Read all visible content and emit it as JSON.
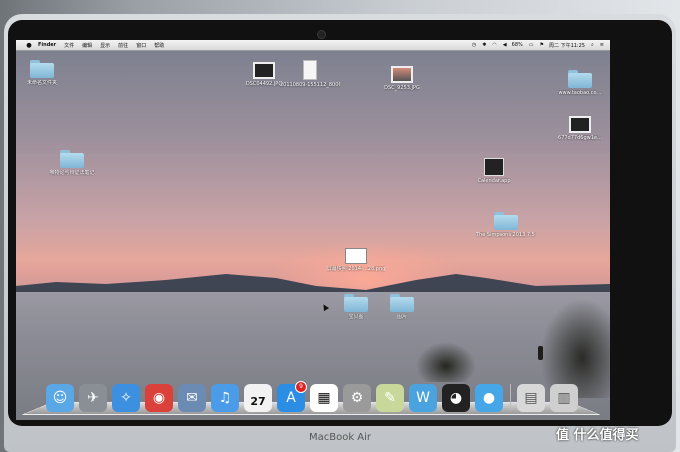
{
  "menubar": {
    "app_name": "Finder",
    "items": [
      "文件",
      "编辑",
      "显示",
      "前往",
      "窗口",
      "帮助"
    ],
    "battery": "68%",
    "clock": "周二 下午11:25"
  },
  "desktop": {
    "icons": [
      {
        "label": "未命名文件夹",
        "kind": "folder"
      },
      {
        "label": "DSC04492.JPG",
        "kind": "thumb"
      },
      {
        "label": "20110809-155112_8006.jpg",
        "kind": "doc"
      },
      {
        "label": "DSC_9253.JPG",
        "kind": "sunset"
      },
      {
        "label": "www.taobao.co…",
        "kind": "folder"
      },
      {
        "label": "677d77d6gw1e…",
        "kind": "thumb"
      },
      {
        "label": "唯物论与辩证法笔记",
        "kind": "folder"
      },
      {
        "label": "Calendar.app",
        "kind": "cal"
      },
      {
        "label": "The Simpsons 2013.7.5 - Wiki",
        "kind": "folder"
      },
      {
        "label": "屏幕快照 2014-…28.png",
        "kind": "shot"
      },
      {
        "label": "宝贝图",
        "kind": "folder"
      },
      {
        "label": "图片",
        "kind": "folder"
      }
    ]
  },
  "dock": {
    "apps": [
      {
        "icon": "finder-icon",
        "color": "#5aa7e6"
      },
      {
        "icon": "launchpad-icon",
        "color": "#8a8f96"
      },
      {
        "icon": "safari-icon",
        "color": "#3d8fe0"
      },
      {
        "icon": "chrome-icon",
        "color": "#d9413a"
      },
      {
        "icon": "mail-icon",
        "color": "#6b8bb3"
      },
      {
        "icon": "itunes-icon",
        "color": "#4a9be8"
      },
      {
        "icon": "calendar-icon",
        "color": "#f2f2f2",
        "day": "27"
      },
      {
        "icon": "app-store-icon",
        "color": "#2b8de3",
        "badge": "9"
      },
      {
        "icon": "qr-code-icon",
        "color": "#ffffff"
      },
      {
        "icon": "system-preferences-icon",
        "color": "#9a9a9a"
      },
      {
        "icon": "text-icon",
        "color": "#c8d89a"
      },
      {
        "icon": "wps-icon",
        "color": "#4aa3df"
      },
      {
        "icon": "qq-icon",
        "color": "#222222"
      },
      {
        "icon": "blue-bird-icon",
        "color": "#46a7e8"
      }
    ],
    "right": [
      {
        "icon": "document-stack-icon",
        "color": "#d8d8d8"
      },
      {
        "icon": "trash-icon",
        "color": "#cfcfcf"
      }
    ]
  },
  "laptop_label": "MacBook Air",
  "watermark": "值 什么值得买"
}
